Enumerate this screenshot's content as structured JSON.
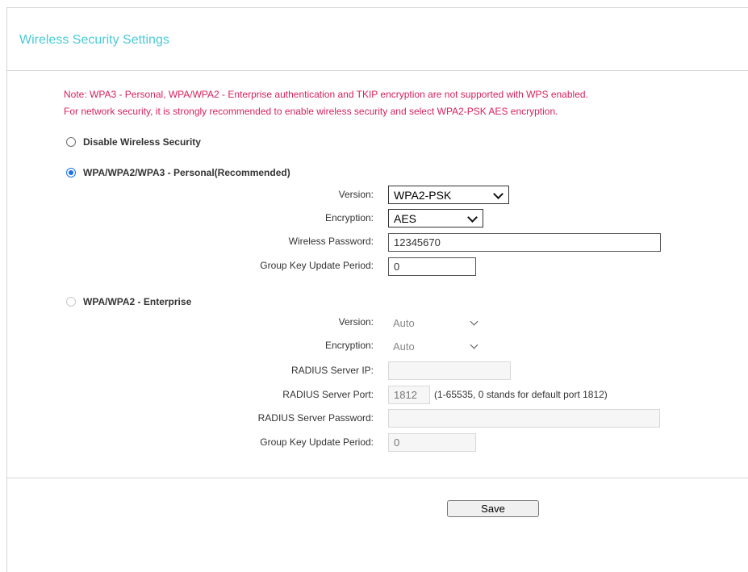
{
  "page": {
    "title": "Wireless Security Settings"
  },
  "notes": {
    "line1": "Note: WPA3 - Personal, WPA/WPA2 - Enterprise authentication and TKIP encryption are not supported with WPS enabled.",
    "line2": "For network security, it is strongly recommended to enable wireless security and select WPA2-PSK AES encryption."
  },
  "options": {
    "disable": {
      "label": "Disable Wireless Security",
      "selected": false
    },
    "personal": {
      "label": "WPA/WPA2/WPA3 - Personal(Recommended)",
      "selected": true
    },
    "enterprise": {
      "label": "WPA/WPA2 - Enterprise",
      "selected": false,
      "disabled": true
    }
  },
  "personal": {
    "version_label": "Version:",
    "version_value": "WPA2-PSK",
    "encryption_label": "Encryption:",
    "encryption_value": "AES",
    "password_label": "Wireless Password:",
    "password_value": "12345670",
    "group_key_label": "Group Key Update Period:",
    "group_key_value": "0"
  },
  "enterprise": {
    "version_label": "Version:",
    "version_value": "Auto",
    "encryption_label": "Encryption:",
    "encryption_value": "Auto",
    "radius_ip_label": "RADIUS Server IP:",
    "radius_ip_value": "",
    "radius_port_label": "RADIUS Server Port:",
    "radius_port_value": "1812",
    "radius_port_hint": "(1-65535, 0 stands for default port 1812)",
    "radius_password_label": "RADIUS Server Password:",
    "radius_password_value": "",
    "group_key_label": "Group Key Update Period:",
    "group_key_value": "0"
  },
  "footer": {
    "save_label": "Save"
  },
  "colors": {
    "title": "#4acbd6",
    "note": "#d6225b",
    "radio_selected": "#1a73e8"
  },
  "icons": {
    "select_arrow": "chevron-down-icon"
  }
}
